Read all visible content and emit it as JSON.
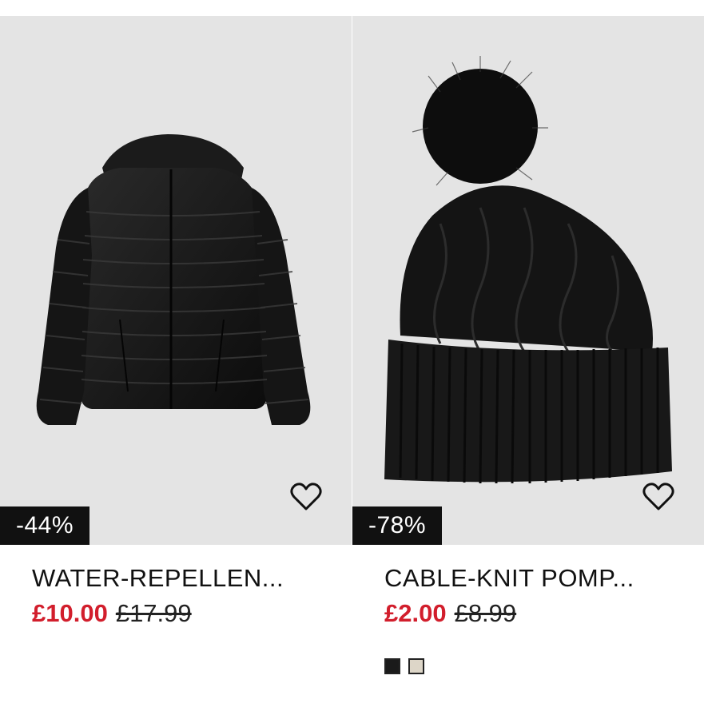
{
  "products": [
    {
      "name": "WATER-REPELLEN...",
      "discount": "-44%",
      "price_now": "£10.00",
      "price_was": "£17.99",
      "swatches": []
    },
    {
      "name": "CABLE-KNIT POMP...",
      "discount": "-78%",
      "price_now": "£2.00",
      "price_was": "£8.99",
      "swatches": [
        {
          "color": "#1a1a1a"
        },
        {
          "color": "#ddd6c8"
        }
      ]
    }
  ],
  "colors": {
    "sale_red": "#d21e2c",
    "badge_bg": "#111111",
    "image_bg": "#e4e4e4"
  }
}
